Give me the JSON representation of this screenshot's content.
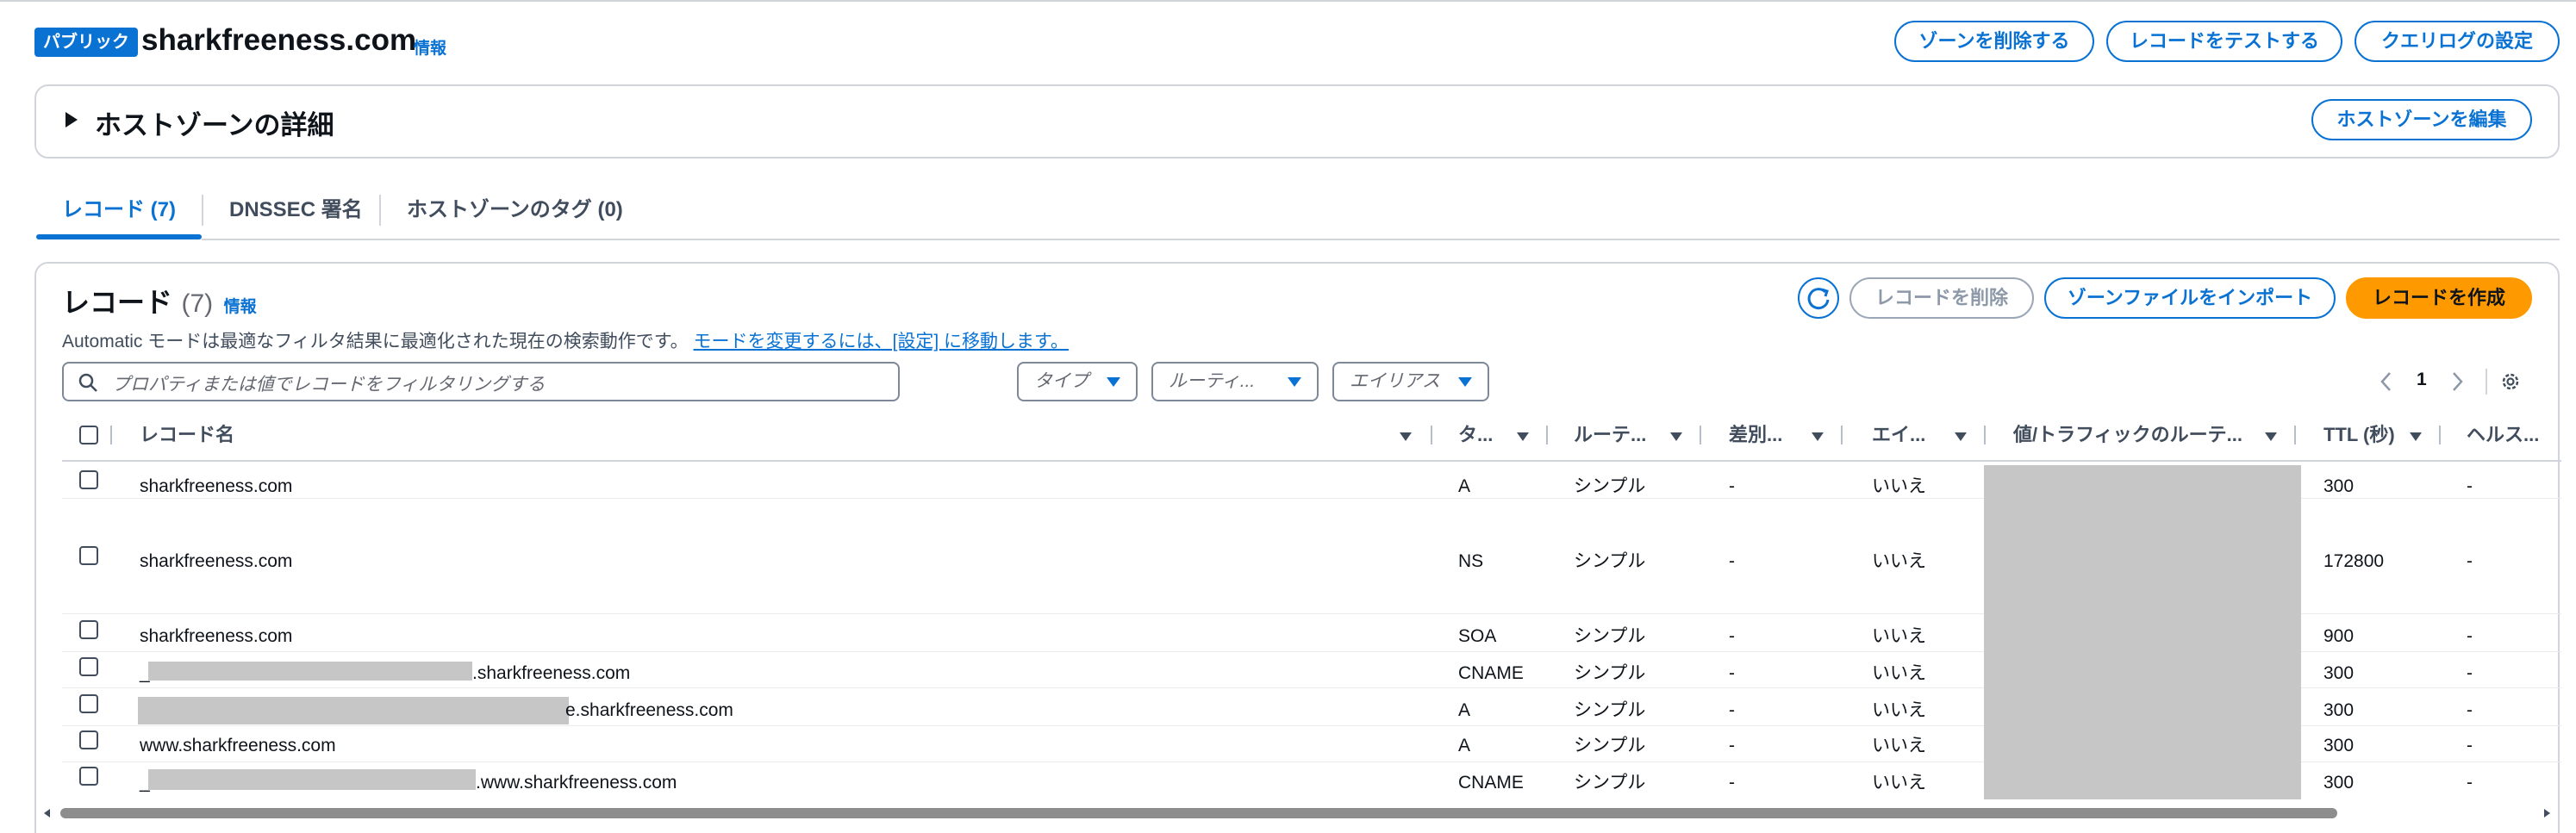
{
  "header": {
    "visibility_badge": "パブリック",
    "zone_name": "sharkfreeness.com",
    "info": "情報",
    "buttons": {
      "delete_zone": "ゾーンを削除する",
      "test_record": "レコードをテストする",
      "query_log": "クエリログの設定"
    }
  },
  "details_panel": {
    "title": "ホストゾーンの詳細",
    "edit_button": "ホストゾーンを編集"
  },
  "tabs": [
    {
      "label": "レコード (7)",
      "active": true
    },
    {
      "label": "DNSSEC 署名",
      "active": false
    },
    {
      "label": "ホストゾーンのタグ (0)",
      "active": false
    }
  ],
  "records_panel": {
    "title": "レコード",
    "count": "(7)",
    "info": "情報",
    "description": "Automatic モードは最適なフィルタ結果に最適化された現在の検索動作です。",
    "description_link": "モードを変更するには、[設定] に移動します。",
    "buttons": {
      "delete": "レコードを削除",
      "import": "ゾーンファイルをインポート",
      "create": "レコードを作成"
    },
    "search_placeholder": "プロパティまたは値でレコードをフィルタリングする",
    "filters": [
      "タイプ",
      "ルーティ...",
      "エイリアス"
    ],
    "page": "1"
  },
  "table": {
    "columns": [
      "レコード名",
      "タ...",
      "ルーテ...",
      "差別...",
      "エイ...",
      "値/トラフィックのルーテ...",
      "TTL (秒)",
      "ヘルス..."
    ],
    "rows": [
      {
        "name": "sharkfreeness.com",
        "type": "A",
        "routing": "シンプル",
        "diff": "-",
        "alias": "いいえ",
        "ttl": "300",
        "health": "-"
      },
      {
        "name": "sharkfreeness.com",
        "type": "NS",
        "routing": "シンプル",
        "diff": "-",
        "alias": "いいえ",
        "ttl": "172800",
        "health": "-"
      },
      {
        "name": "sharkfreeness.com",
        "type": "SOA",
        "routing": "シンプル",
        "diff": "-",
        "alias": "いいえ",
        "ttl": "900",
        "health": "-"
      },
      {
        "name_prefix": "_",
        "name_suffix": ".sharkfreeness.com",
        "type": "CNAME",
        "routing": "シンプル",
        "diff": "-",
        "alias": "いいえ",
        "ttl": "300",
        "health": "-"
      },
      {
        "name_suffix": "e.sharkfreeness.com",
        "type": "A",
        "routing": "シンプル",
        "diff": "-",
        "alias": "いいえ",
        "ttl": "300",
        "health": "-"
      },
      {
        "name": "www.sharkfreeness.com",
        "type": "A",
        "routing": "シンプル",
        "diff": "-",
        "alias": "いいえ",
        "ttl": "300",
        "health": "-"
      },
      {
        "name_prefix": "_",
        "name_suffix": ".www.sharkfreeness.com",
        "type": "CNAME",
        "routing": "シンプル",
        "diff": "-",
        "alias": "いいえ",
        "ttl": "300",
        "health": "-"
      }
    ]
  },
  "colors": {
    "accent": "#0972d3",
    "primary_button": "#ff9900",
    "redaction": "#c6c6c6"
  },
  "icons": [
    "refresh-icon",
    "search-icon",
    "settings-icon",
    "chevron-left-icon",
    "chevron-right-icon",
    "sort-icon",
    "caret-right-icon"
  ]
}
